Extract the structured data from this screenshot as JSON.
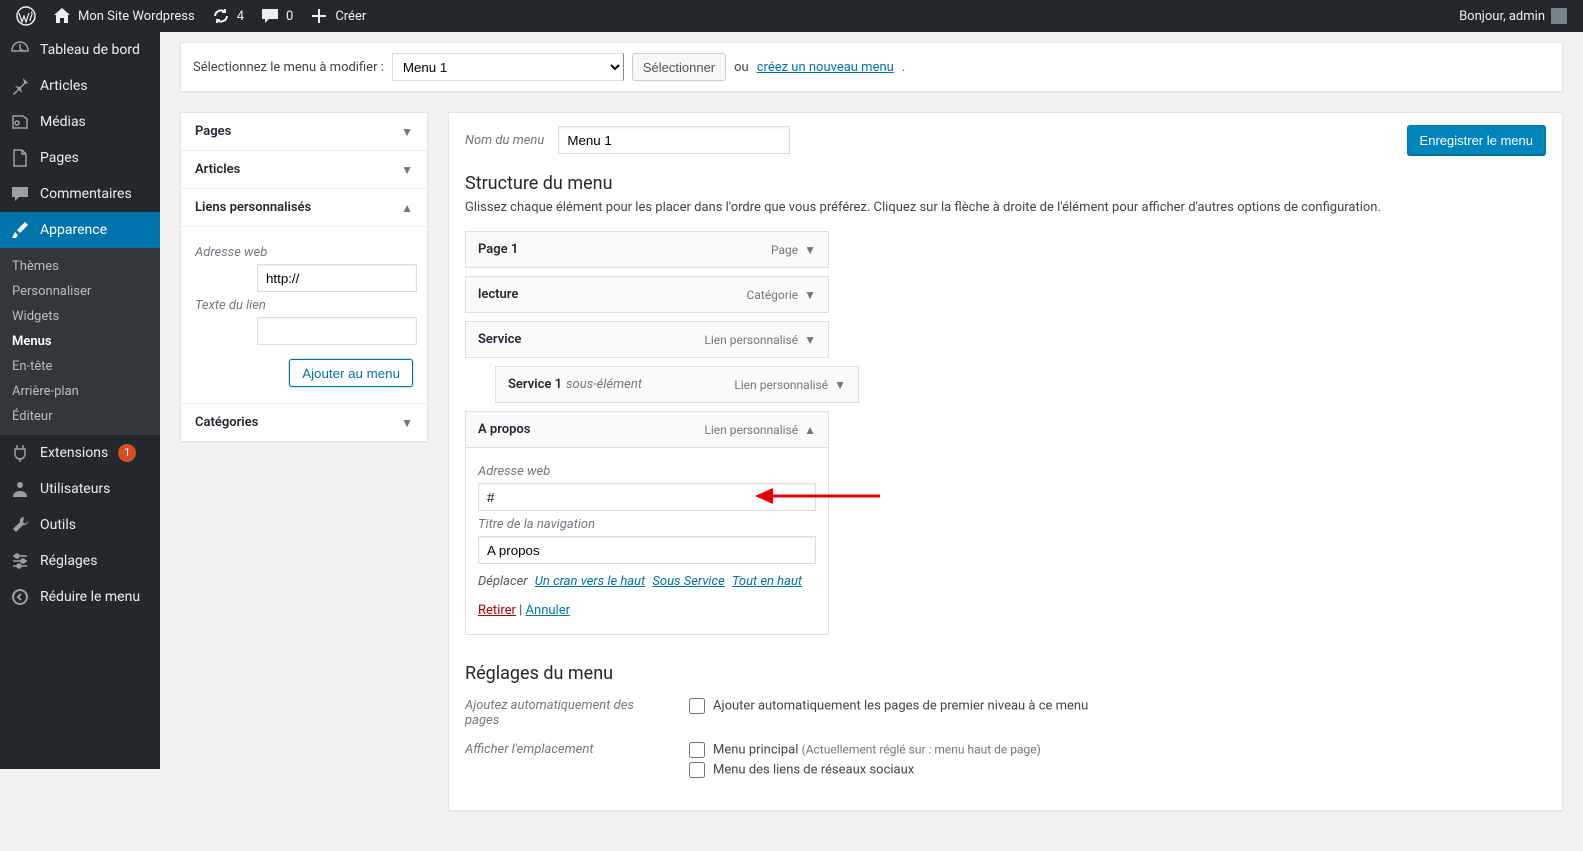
{
  "toolbar": {
    "site_name": "Mon Site Wordpress",
    "updates": "4",
    "comments": "0",
    "new": "Créer",
    "greeting": "Bonjour, admin"
  },
  "adminmenu": {
    "dashboard": "Tableau de bord",
    "posts": "Articles",
    "media": "Médias",
    "pages": "Pages",
    "comments": "Commentaires",
    "appearance": "Apparence",
    "appearance_sub": {
      "themes": "Thèmes",
      "customize": "Personnaliser",
      "widgets": "Widgets",
      "menus": "Menus",
      "header": "En-tête",
      "background": "Arrière-plan",
      "editor": "Éditeur"
    },
    "plugins": "Extensions",
    "plugins_badge": "1",
    "users": "Utilisateurs",
    "tools": "Outils",
    "settings": "Réglages",
    "collapse": "Réduire le menu"
  },
  "selector": {
    "label": "Sélectionnez le menu à modifier :",
    "selected": "Menu 1",
    "button": "Sélectionner",
    "or": "ou",
    "create_link": "créez un nouveau menu",
    "dot": "."
  },
  "left_accordion": {
    "pages": "Pages",
    "articles": "Articles",
    "custom_links": "Liens personnalisés",
    "url_label": "Adresse web",
    "url_value": "http://",
    "text_label": "Texte du lien",
    "add_button": "Ajouter au menu",
    "categories": "Catégories"
  },
  "editor": {
    "name_label": "Nom du menu",
    "name_value": "Menu 1",
    "save_button": "Enregistrer le menu",
    "structure_title": "Structure du menu",
    "structure_desc": "Glissez chaque élément pour les placer dans l'ordre que vous préférez. Cliquez sur la flèche à droite de l'élément pour afficher d'autres options de configuration.",
    "items": [
      {
        "title": "Page 1",
        "type": "Page"
      },
      {
        "title": "lecture",
        "type": "Catégorie"
      },
      {
        "title": "Service",
        "type": "Lien personnalisé"
      },
      {
        "title": "Service 1",
        "sub": "sous-élément",
        "type": "Lien personnalisé"
      },
      {
        "title": "A propos",
        "type": "Lien personnalisé"
      }
    ],
    "expanded": {
      "url_label": "Adresse web",
      "url_value": "#",
      "nav_title_label": "Titre de la navigation",
      "nav_title_value": "A propos",
      "move_label": "Déplacer",
      "move_up": "Un cran vers le haut",
      "move_under": "Sous Service",
      "move_top": "Tout en haut",
      "remove": "Retirer",
      "sep": " | ",
      "cancel": "Annuler"
    },
    "settings_title": "Réglages du menu",
    "auto_add_label": "Ajoutez automatiquement des pages",
    "auto_add_opt": "Ajouter automatiquement les pages de premier niveau à ce menu",
    "location_label": "Afficher l'emplacement",
    "locations": {
      "primary": "Menu principal",
      "primary_hint": "(Actuellement réglé sur : menu haut de page)",
      "social": "Menu des liens de réseaux sociaux"
    }
  }
}
